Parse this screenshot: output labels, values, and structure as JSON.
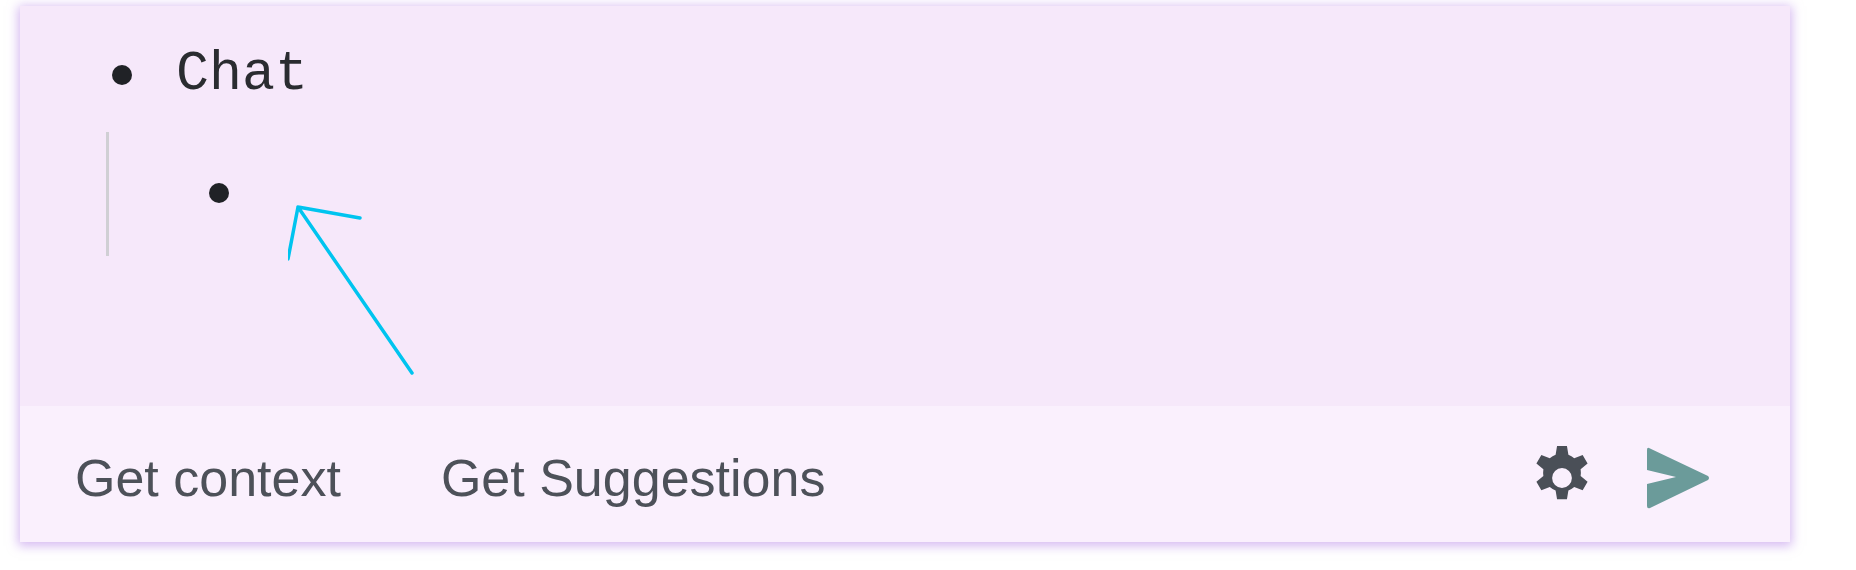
{
  "outline": [
    {
      "kind": "text",
      "text": "Chat",
      "children": [
        {
          "kind": "bullet"
        }
      ]
    }
  ],
  "footer": {
    "actions": [
      "Get context",
      "Get Suggestions"
    ]
  }
}
